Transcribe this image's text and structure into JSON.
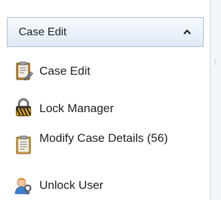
{
  "nav": {
    "group_title": "Case Edit",
    "items": [
      {
        "label": "Case Edit",
        "icon": "clipboard-edit-icon"
      },
      {
        "label": "Lock Manager",
        "icon": "padlock-icon"
      },
      {
        "label": "Modify Case Details (56)",
        "icon": "clipboard-icon"
      },
      {
        "label": "Unlock User",
        "icon": "user-key-icon"
      }
    ]
  },
  "colors": {
    "pane_background": "#ffffff",
    "header_border": "#a9bfd6",
    "header_gradient_top": "#f7fafd",
    "header_gradient_bottom": "#dfe9f5",
    "right_area": "#f3f6fa"
  }
}
